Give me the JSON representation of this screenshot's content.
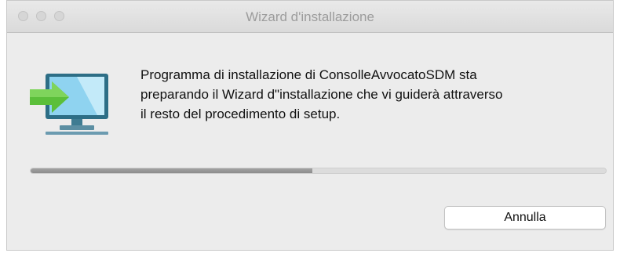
{
  "window": {
    "title": "Wizard d'installazione"
  },
  "message": {
    "lines": [
      "Programma di installazione di ConsolleAvvocatoSDM sta",
      "preparando il Wizard d\"installazione che vi guiderà attraverso",
      "il resto del procedimento di setup."
    ]
  },
  "progress": {
    "fraction": 0.49
  },
  "buttons": {
    "cancel_label": "Annulla"
  },
  "icons": {
    "main": "computer-install-icon"
  },
  "colors": {
    "arrow": "#5bbf3a",
    "screen": "#8fd3f0",
    "monitor_frame": "#2d6e86"
  }
}
